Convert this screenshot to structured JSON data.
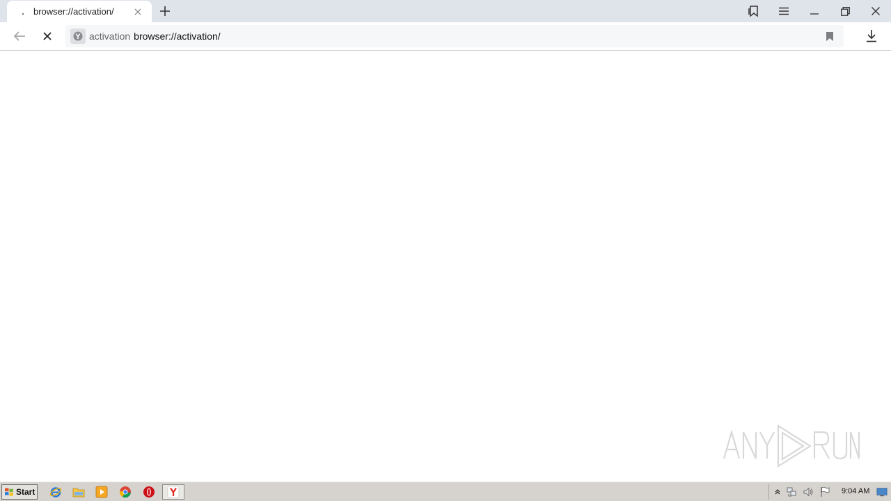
{
  "browser": {
    "tab": {
      "title": "browser://activation/"
    },
    "omnibox": {
      "domain": "activation",
      "url": "browser://activation/"
    }
  },
  "taskbar": {
    "start_label": "Start",
    "pinned": [
      "internet-explorer-icon",
      "file-explorer-icon",
      "media-player-icon",
      "chrome-icon",
      "opera-icon",
      "yandex-browser-icon"
    ],
    "clock": "9:04 AM"
  },
  "watermark": {
    "text": "ANY RUN"
  },
  "colors": {
    "tabstrip": "#dfe3ea",
    "omnibox": "#f6f7f9",
    "taskbar": "#d6d3ce",
    "opera": "#cc0f16",
    "yandex": "#e52620"
  }
}
